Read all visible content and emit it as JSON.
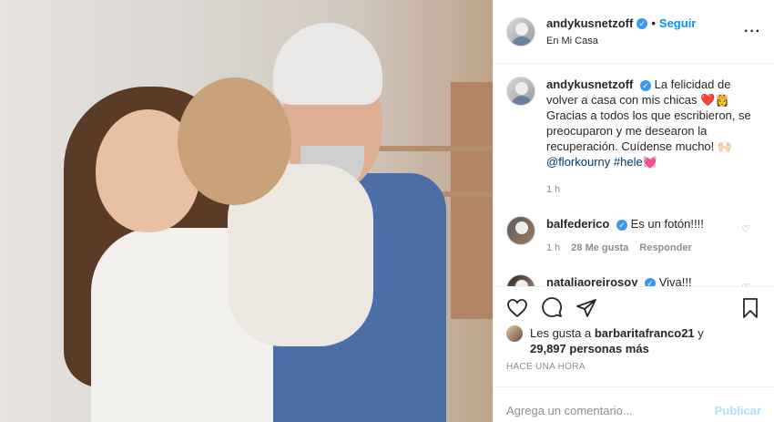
{
  "post": {
    "author": "andykusnetzoff",
    "follow_label": "Seguir",
    "separator": "•",
    "location": "En Mi Casa",
    "more_label": "···"
  },
  "caption": {
    "username": "andykusnetzoff",
    "text": "La felicidad de volver a casa con mis chicas ❤️👸 Gracias a todos los que escribieron, se preocuparon y me desearon la recuperación. Cuídense mucho! 🙌🏻",
    "mention": "@florkourny",
    "hashtag": "#hele",
    "hashtag_emoji": "💓",
    "time": "1 h"
  },
  "comments": [
    {
      "username": "balfederico",
      "text": "Es un fotón!!!!",
      "time": "1 h",
      "likes": "28 Me gusta",
      "reply": "Responder"
    },
    {
      "username": "nataliaoreirosoy",
      "text": "Viva!!!"
    }
  ],
  "likes_summary": {
    "prefix": "Les gusta a",
    "user": "barbaritafranco21",
    "joiner": "y",
    "count": "29,897 personas más"
  },
  "timestamp": "HACE UNA HORA",
  "composer": {
    "placeholder": "Agrega un comentario...",
    "publish_label": "Publicar"
  },
  "colors": {
    "accent": "#0095f6",
    "verified": "#3897f0",
    "muted": "#8e8e8e",
    "publish_disabled": "#b2dffc"
  },
  "icons": [
    "verified-badge-icon",
    "more-options-icon",
    "heart-icon",
    "comment-icon",
    "share-icon",
    "bookmark-icon"
  ]
}
